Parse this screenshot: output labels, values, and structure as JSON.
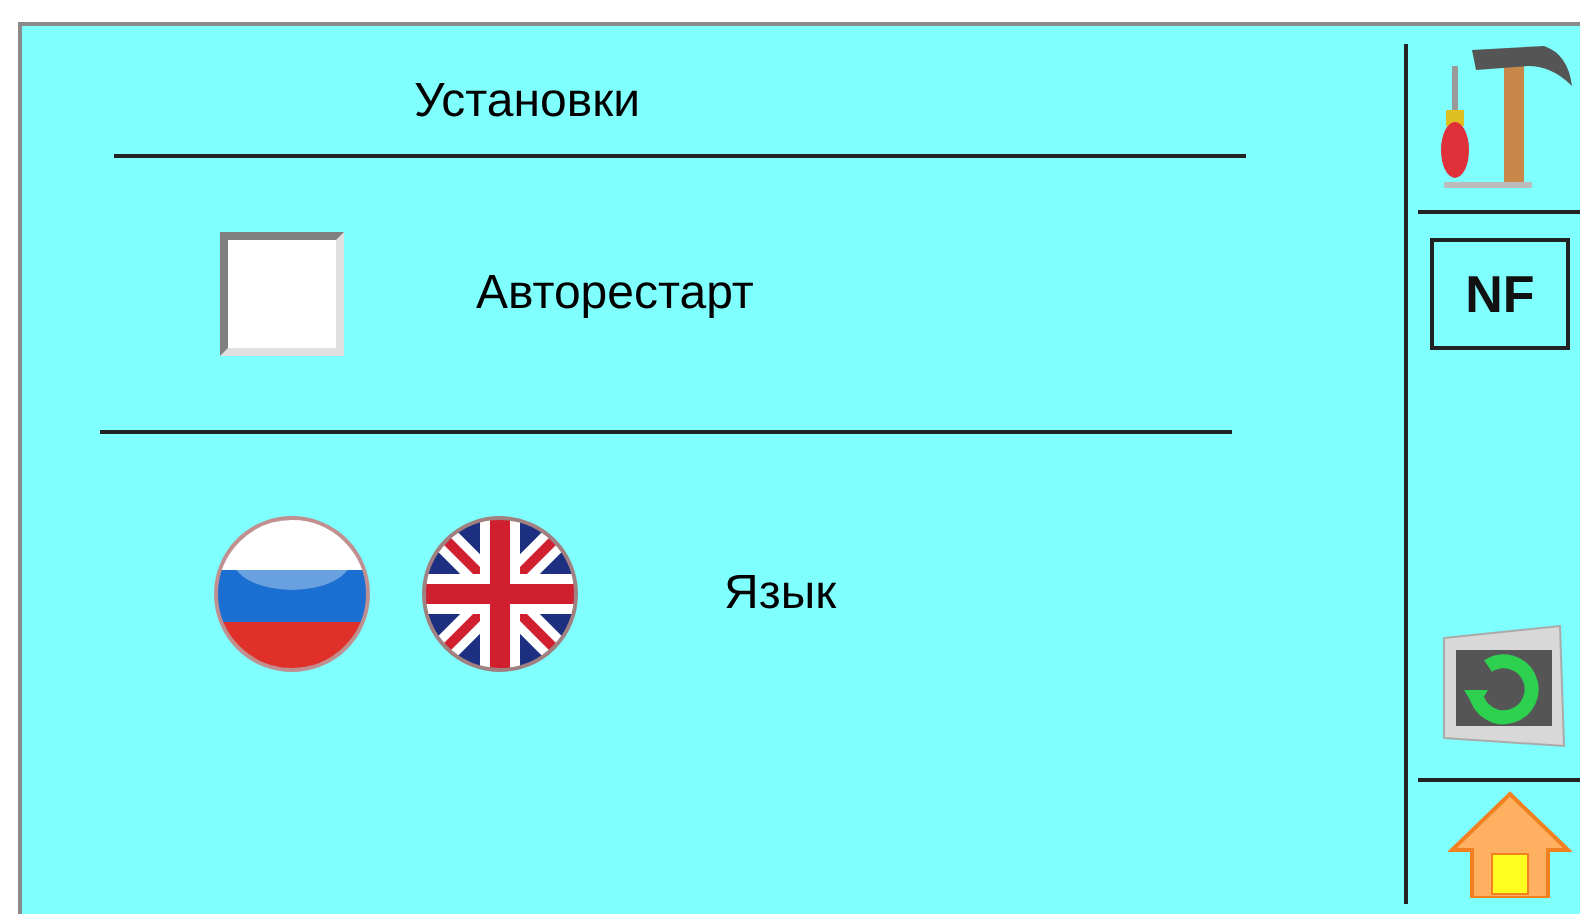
{
  "title": "Установки",
  "autorestart": {
    "label": "Авторестарт",
    "checked": false
  },
  "language": {
    "label": "Язык"
  },
  "sidebar": {
    "nf_button": "NF"
  }
}
